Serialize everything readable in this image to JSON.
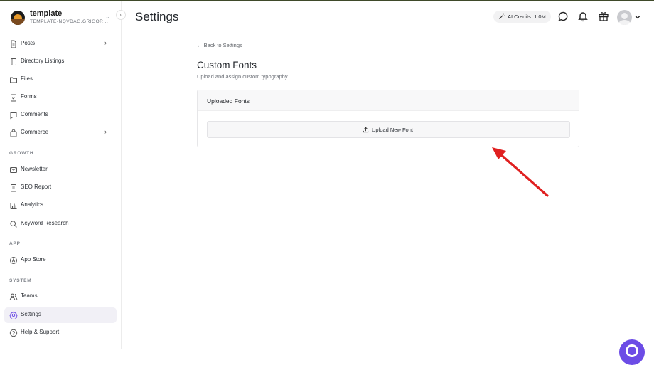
{
  "sidebar": {
    "brand_name": "template",
    "brand_sub": "TEMPLATE-NQVDAG.GRIGOR...",
    "collapse_icon": "chevron-left-icon",
    "sections": {
      "growth": "GROWTH",
      "app": "APP",
      "system": "SYSTEM"
    },
    "items": [
      {
        "label": "Posts",
        "icon": "document-icon",
        "has_arrow": true
      },
      {
        "label": "Directory Listings",
        "icon": "book-icon"
      },
      {
        "label": "Files",
        "icon": "folder-icon"
      },
      {
        "label": "Forms",
        "icon": "clipboard-check-icon"
      },
      {
        "label": "Comments",
        "icon": "comment-icon"
      },
      {
        "label": "Commerce",
        "icon": "shopping-bag-icon",
        "has_arrow": true
      },
      {
        "label": "Newsletter",
        "icon": "mail-icon"
      },
      {
        "label": "SEO Report",
        "icon": "report-icon"
      },
      {
        "label": "Analytics",
        "icon": "bar-chart-icon"
      },
      {
        "label": "Keyword Research",
        "icon": "search-icon"
      },
      {
        "label": "App Store",
        "icon": "app-store-icon"
      },
      {
        "label": "Teams",
        "icon": "users-icon"
      },
      {
        "label": "Settings",
        "icon": "gear-icon",
        "active": true
      },
      {
        "label": "Help & Support",
        "icon": "help-icon"
      }
    ]
  },
  "header": {
    "title": "Settings",
    "credits_label": "AI Credits: 1.0M",
    "icons": [
      "magic-wand-icon",
      "chat-icon",
      "bell-icon",
      "gift-icon",
      "avatar",
      "chevron-down-icon"
    ]
  },
  "main": {
    "back_link": "← Back to Settings",
    "title": "Custom Fonts",
    "subtitle": "Upload and assign custom typography.",
    "card_title": "Uploaded Fonts",
    "upload_label": "Upload New Font"
  },
  "colors": {
    "accent": "#6c4ce6",
    "annotation_arrow": "#e02020",
    "active_bg": "#f1f0f6"
  }
}
